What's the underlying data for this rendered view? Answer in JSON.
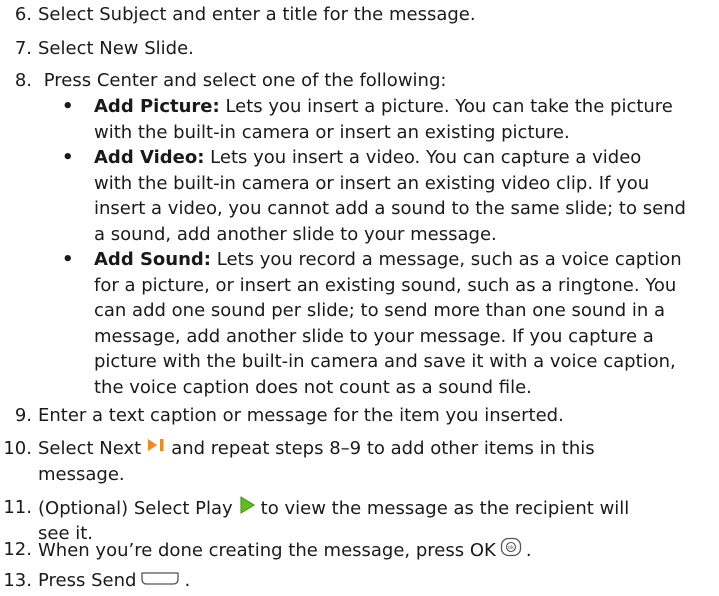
{
  "steps": [
    {
      "num": "6.",
      "text": "Select Subject and enter a title for the message."
    },
    {
      "num": "7.",
      "text": "Select New Slide."
    },
    {
      "num": "8.",
      "text": " Press Center and select one of the following:"
    },
    {
      "num": "9.",
      "text": "Enter a text caption or message for the item you inserted."
    },
    {
      "num": "10.",
      "pre": "Select Next",
      "post": "and repeat steps 8–9 to add other items in this",
      "cont": "message.",
      "icon": "next-slide-icon"
    },
    {
      "num": "11.",
      "pre": "(Optional) Select Play",
      "post": "to view the message as the recipient will",
      "cont": "see it.",
      "icon": "play-icon"
    },
    {
      "num": "12.",
      "pre": "When you’re done creating the message, press OK",
      "post": ".",
      "icon": "ok-key-icon"
    },
    {
      "num": "13.",
      "pre": "Press Send",
      "post": ".",
      "icon": "send-key-icon"
    }
  ],
  "bullets": [
    {
      "bullet": "•",
      "term": "Add Picture:",
      "lines": [
        "Lets you insert a picture. You can take the picture",
        "with the built-in camera or insert an existing picture."
      ]
    },
    {
      "bullet": "•",
      "term": "Add Video:",
      "lines": [
        "Lets you insert a video. You can capture a video",
        "with the built-in camera or insert an existing video clip. If you",
        "insert a video, you cannot add a sound to the same slide; to send",
        "a sound, add another slide to your message."
      ]
    },
    {
      "bullet": "•",
      "term": "Add Sound:",
      "lines": [
        "Lets you record a message, such as a voice caption",
        "for a picture, or insert an existing sound, such as a ringtone. You",
        "can add one sound per slide; to send more than one sound in a",
        "message, add another slide to your message. If you capture a",
        "picture with the built-in camera and save it with a voice caption,",
        "the voice caption does not count as a sound file."
      ]
    }
  ],
  "colors": {
    "accent_orange": "#f08a1c",
    "accent_green": "#5cc21a",
    "text": "#1a1a1a"
  }
}
